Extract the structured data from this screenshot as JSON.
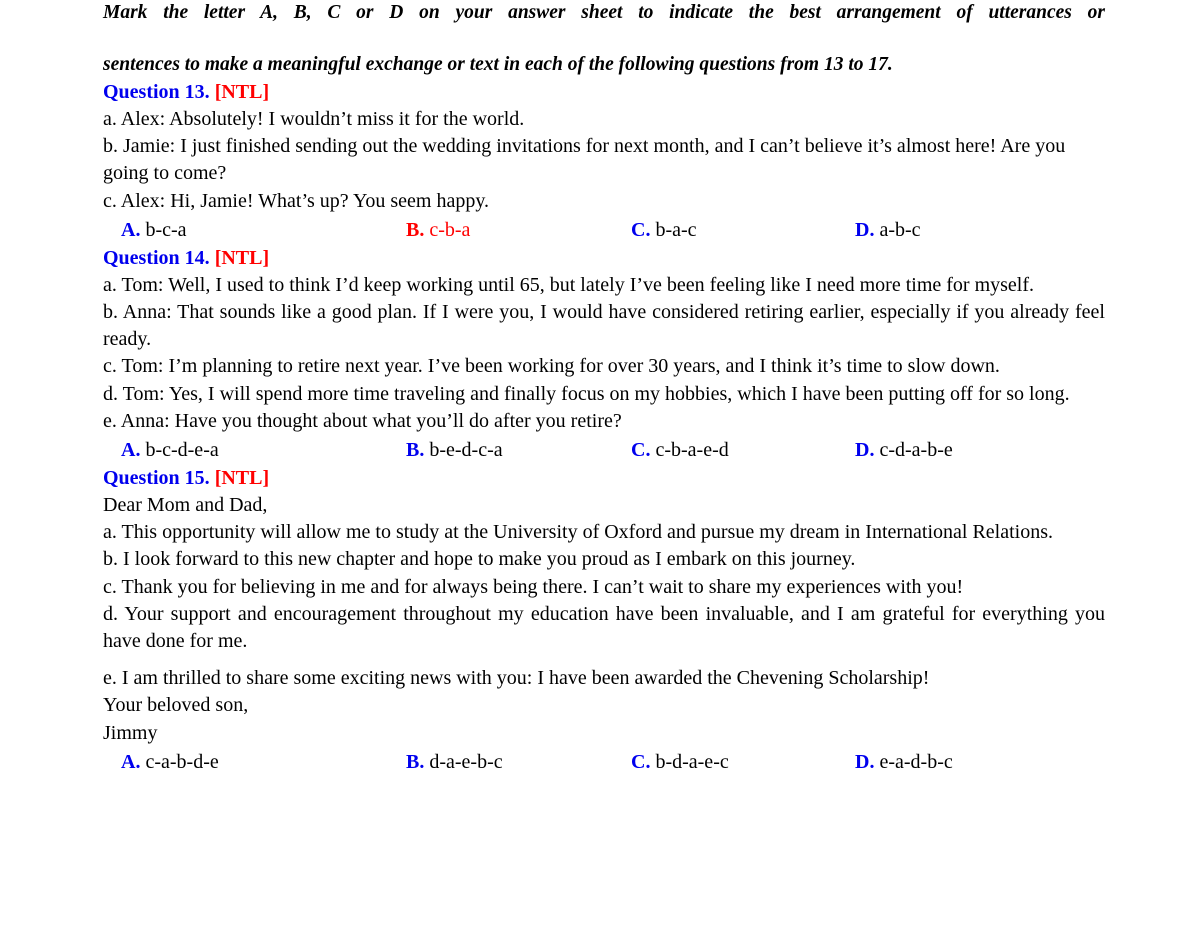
{
  "colors": {
    "blue": "#0000ee",
    "red": "#ff0000",
    "black": "#000000",
    "background": "#ffffff"
  },
  "instruction": {
    "line1": "Mark the letter A, B, C or D on your answer sheet to indicate the best arrangement of utterances  or",
    "line2": "sentences to make a meaningful exchange or text in each of the following questions from 13 to 17."
  },
  "questions": [
    {
      "label": "Question 13.",
      "tag": "[NTL]",
      "items": [
        "a. Alex: Absolutely! I wouldn’t miss it for the world.",
        "b. Jamie: I just finished sending out the wedding invitations for next month, and I can’t believe it’s almost here! Are you going to come?",
        "c. Alex: Hi, Jamie! What’s up? You seem happy."
      ],
      "options": [
        {
          "letter": "A.",
          "value": "b-c-a",
          "correct": false
        },
        {
          "letter": "B.",
          "value": "c-b-a",
          "correct": true
        },
        {
          "letter": "C.",
          "value": "b-a-c",
          "correct": false
        },
        {
          "letter": "D.",
          "value": "a-b-c",
          "correct": false
        }
      ]
    },
    {
      "label": "Question 14.",
      "tag": "[NTL]",
      "items": [
        "a. Tom: Well, I used to think I’d keep working until 65, but lately I’ve been feeling like I need more time for myself.",
        "b. Anna: That sounds like a good plan. If I were you, I would have considered retiring earlier, especially if you already feel ready.",
        "c. Tom: I’m planning to retire next year. I’ve been working for over 30 years, and I think it’s time to slow down.",
        "d. Tom: Yes, I will spend more time traveling and finally focus on my hobbies, which I have been putting off for so long.",
        "e. Anna: Have you thought about what you’ll do after you retire?"
      ],
      "options": [
        {
          "letter": "A.",
          "value": "b-c-d-e-a",
          "correct": false
        },
        {
          "letter": "B.",
          "value": "b-e-d-c-a",
          "correct": false
        },
        {
          "letter": "C.",
          "value": "c-b-a-e-d",
          "correct": false
        },
        {
          "letter": "D.",
          "value": "c-d-a-b-e",
          "correct": false
        }
      ]
    },
    {
      "label": "Question 15.",
      "tag": "[NTL]",
      "salutation": "Dear Mom and Dad,",
      "items": [
        "a. This opportunity will allow me to study at the University of Oxford and pursue my dream in International Relations.",
        "b. I look forward to this new chapter and hope to make you proud as I embark on this journey.",
        "c. Thank you for believing in me and for always being there. I can’t wait to share my experiences with you!",
        "d. Your support and encouragement throughout my education have been invaluable, and I am grateful for everything you have done for me.",
        "e.  I am thrilled to share some exciting news with you: I have been awarded the Chevening Scholarship!"
      ],
      "closing": "Your beloved son,",
      "signature": "Jimmy",
      "options": [
        {
          "letter": "A.",
          "value": "c-a-b-d-e",
          "correct": false
        },
        {
          "letter": "B.",
          "value": "d-a-e-b-c",
          "correct": false
        },
        {
          "letter": "C.",
          "value": "b-d-a-e-c",
          "correct": false
        },
        {
          "letter": "D.",
          "value": "e-a-d-b-c",
          "correct": false
        }
      ]
    }
  ]
}
